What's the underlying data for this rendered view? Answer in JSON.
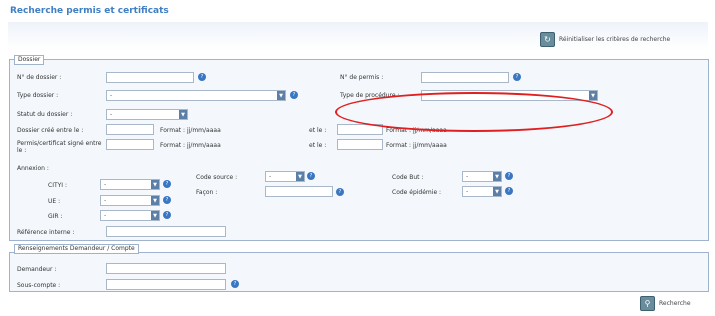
{
  "page": {
    "title": "Recherche permis et certificats"
  },
  "toolbar": {
    "reset_label": "Réinitialiser les critères de recherche",
    "reset_icon": "refresh-icon"
  },
  "dossier": {
    "legend": "Dossier",
    "no_dossier_label": "N° de dossier :",
    "no_permis_label": "N° de permis :",
    "type_dossier_label": "Type dossier :",
    "type_dossier_value": "-",
    "type_procedure_label": "Type de procédure :",
    "type_procedure_value": "",
    "statut_label": "Statut du dossier :",
    "statut_value": "-",
    "depot_label": "Dossier créé entre le :",
    "signe_label": "Permis/certificat signé entre le :",
    "format_label": "Format : jj/mm/aaaa",
    "et_le_label": "et le :",
    "annexion_label": "Annexion :",
    "cityi_label": "CITYI :",
    "cityi_value": "-",
    "ue_label": "UE :",
    "ue_value": "-",
    "gir_label": "GIR :",
    "gir_value": "-",
    "code_source_label": "Code source :",
    "code_source_value": "-",
    "facon_label": "Façon :",
    "code_but_label": "Code But :",
    "code_but_value": "-",
    "code_epidemie_label": "Code épidémie :",
    "code_epidemie_value": "-",
    "reference_label": "Référence interne :"
  },
  "demandeur": {
    "legend": "Renseignements Demandeur / Compte",
    "demandeur_label": "Demandeur :",
    "sous_compte_label": "Sous-compte :"
  },
  "actions": {
    "search_label": "Recherche",
    "search_icon": "search-icon"
  },
  "colors": {
    "accent": "#3f7fc4",
    "highlight": "#e02020"
  }
}
